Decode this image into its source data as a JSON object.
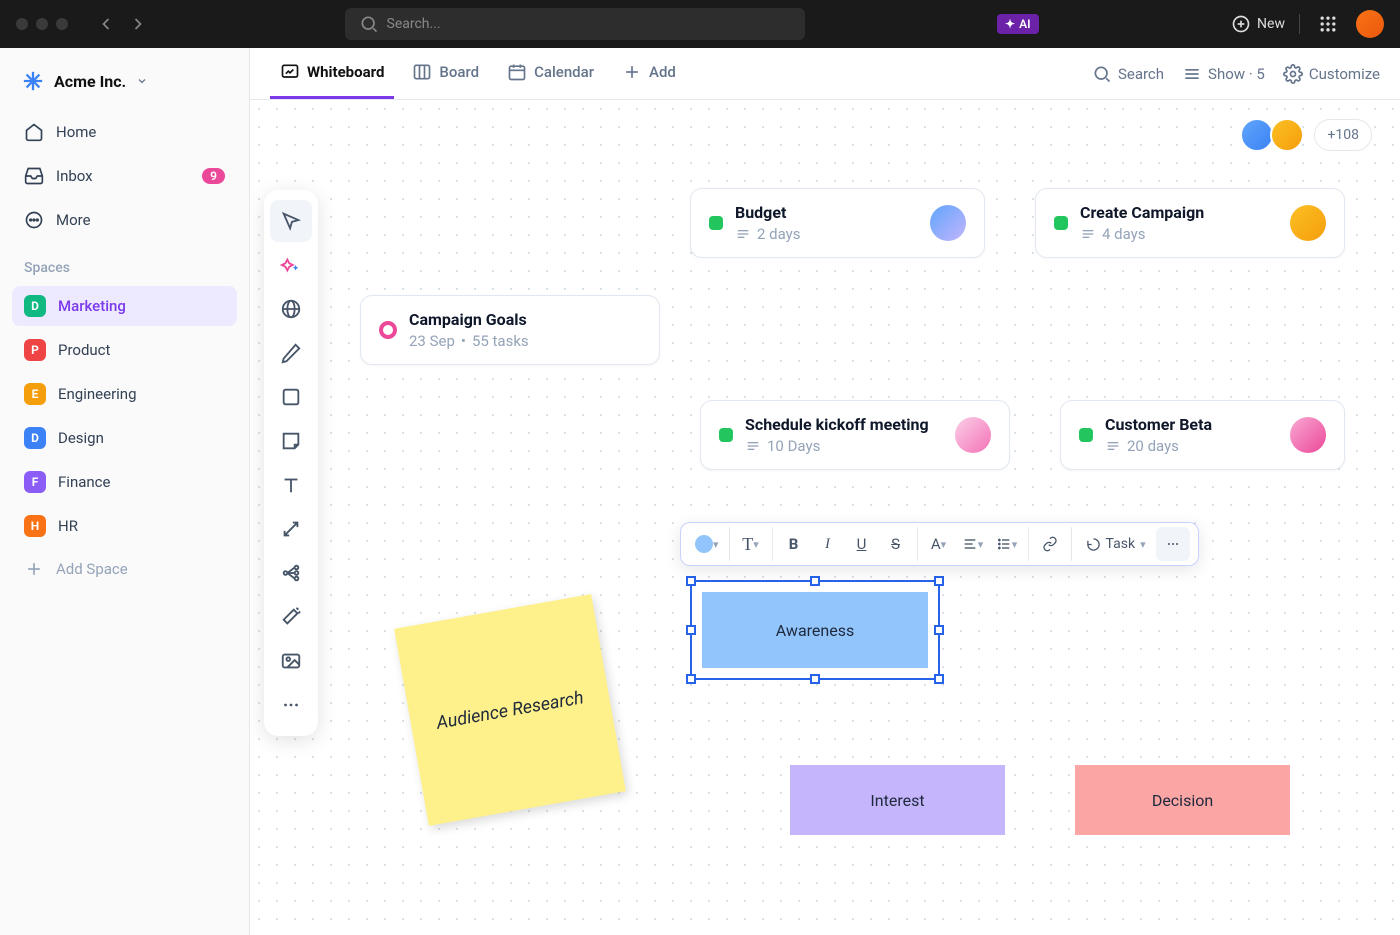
{
  "topbar": {
    "search_placeholder": "Search...",
    "ai_label": "AI",
    "new_label": "New"
  },
  "workspace": {
    "name": "Acme Inc."
  },
  "nav": {
    "home": "Home",
    "inbox": "Inbox",
    "inbox_count": "9",
    "more": "More"
  },
  "spaces_label": "Spaces",
  "spaces": [
    {
      "letter": "D",
      "name": "Marketing",
      "color": "#10b981",
      "active": true
    },
    {
      "letter": "P",
      "name": "Product",
      "color": "#ef4444"
    },
    {
      "letter": "E",
      "name": "Engineering",
      "color": "#f59e0b"
    },
    {
      "letter": "D",
      "name": "Design",
      "color": "#3b82f6"
    },
    {
      "letter": "F",
      "name": "Finance",
      "color": "#8b5cf6"
    },
    {
      "letter": "H",
      "name": "HR",
      "color": "#f97316"
    }
  ],
  "add_space_label": "Add Space",
  "views": {
    "whiteboard": "Whiteboard",
    "board": "Board",
    "calendar": "Calendar",
    "add": "Add",
    "search": "Search",
    "show": "Show · 5",
    "customize": "Customize"
  },
  "collab_more": "+108",
  "cards": {
    "goals": {
      "title": "Campaign Goals",
      "date": "23 Sep",
      "tasks": "55 tasks"
    },
    "budget": {
      "title": "Budget",
      "duration": "2 days",
      "status_color": "#22c55e"
    },
    "create": {
      "title": "Create Campaign",
      "duration": "4 days",
      "status_color": "#22c55e"
    },
    "kickoff": {
      "title": "Schedule kickoff meeting",
      "duration": "10 Days",
      "status_color": "#22c55e"
    },
    "beta": {
      "title": "Customer Beta",
      "duration": "20 days",
      "status_color": "#22c55e"
    }
  },
  "sticky": {
    "text": "Audience Research"
  },
  "shapes": {
    "awareness": "Awareness",
    "interest": "Interest",
    "decision": "Decision"
  },
  "fmt": {
    "task_label": "Task"
  },
  "colors": {
    "accent": "#7c3aed",
    "pink": "#ec4899",
    "blue_shape": "#93c5fd",
    "purple_shape": "#c4b5fd",
    "red_shape": "#fca5a5"
  }
}
